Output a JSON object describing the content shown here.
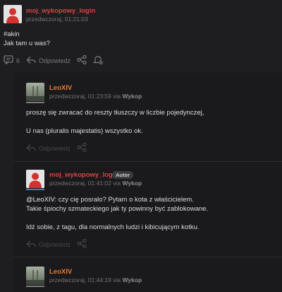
{
  "posts": [
    {
      "login": "moj_wykopowy_login",
      "timestamp": "przedwczoraj, 01:21:03",
      "lines": [
        "#akin",
        "Jak tam u was?"
      ],
      "comment_count": "6",
      "reply_label": "Odpowiedz"
    },
    {
      "login": "LeoXIV",
      "timestamp": "przedwczoraj, 01:23:59",
      "via_prefix": "via",
      "via_source": "Wykop",
      "lines": [
        "proszę się zwracać do reszty tłuszczy w liczbie pojedynczej,",
        "",
        "U nas (pluralis majestatis) wszystko ok."
      ],
      "reply_label": "Odpowiedz"
    },
    {
      "login": "moj_wykopowy_login",
      "badge": "Autor",
      "timestamp": "przedwczoraj, 01:41:02",
      "via_prefix": "via",
      "via_source": "Wykop",
      "mention": "@LeoXIV",
      "line1_rest": ": czy cię posralo? Pytam o kota z właścicielem.",
      "lines": [
        "Takie śpiochy szmateckiego jak ty powinny być zablokowane.",
        "",
        "Idź sobie, z tagu, dla normalnych ludzi i kibicującym kotku."
      ],
      "reply_label": "Odpowiedz"
    },
    {
      "login": "LeoXIV",
      "timestamp": "przedwczoraj, 01:44:19",
      "via_prefix": "via",
      "via_source": "Wykop"
    }
  ],
  "icons": [
    "comments-icon",
    "reply-icon",
    "share-icon",
    "notification-bell-icon"
  ],
  "colors": {
    "background": "#1e1e20",
    "author_login": "#d64542",
    "other_login": "#ea7a33"
  }
}
